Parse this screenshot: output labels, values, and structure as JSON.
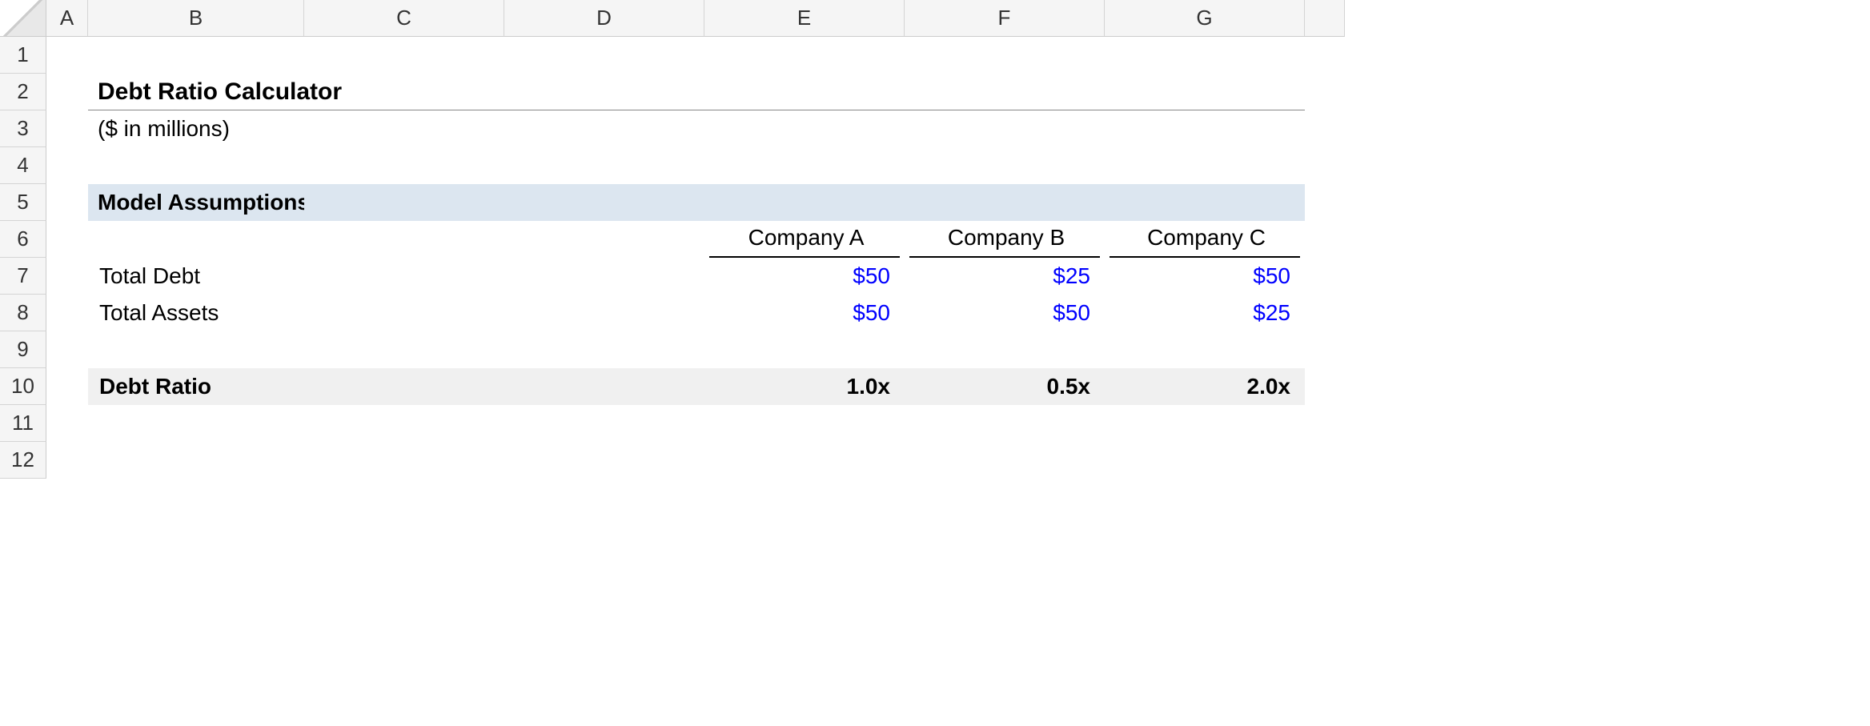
{
  "columns": [
    "A",
    "B",
    "C",
    "D",
    "E",
    "F",
    "G"
  ],
  "rows": [
    "1",
    "2",
    "3",
    "4",
    "5",
    "6",
    "7",
    "8",
    "9",
    "10",
    "11",
    "12"
  ],
  "title": "Debt Ratio Calculator",
  "subtitle": "($ in millions)",
  "section_header": "Model Assumptions",
  "companies": {
    "a": "Company A",
    "b": "Company B",
    "c": "Company C"
  },
  "labels": {
    "total_debt": "Total Debt",
    "total_assets": "Total Assets",
    "debt_ratio": "Debt Ratio"
  },
  "values": {
    "debt_a": "$50",
    "debt_b": "$25",
    "debt_c": "$50",
    "assets_a": "$50",
    "assets_b": "$50",
    "assets_c": "$25",
    "ratio_a": "1.0x",
    "ratio_b": "0.5x",
    "ratio_c": "2.0x"
  },
  "chart_data": {
    "type": "table",
    "title": "Debt Ratio Calculator",
    "unit": "$ in millions",
    "companies": [
      "Company A",
      "Company B",
      "Company C"
    ],
    "series": [
      {
        "name": "Total Debt",
        "values": [
          50,
          25,
          50
        ]
      },
      {
        "name": "Total Assets",
        "values": [
          50,
          50,
          25
        ]
      },
      {
        "name": "Debt Ratio",
        "values": [
          1.0,
          0.5,
          2.0
        ],
        "unit": "x"
      }
    ]
  }
}
